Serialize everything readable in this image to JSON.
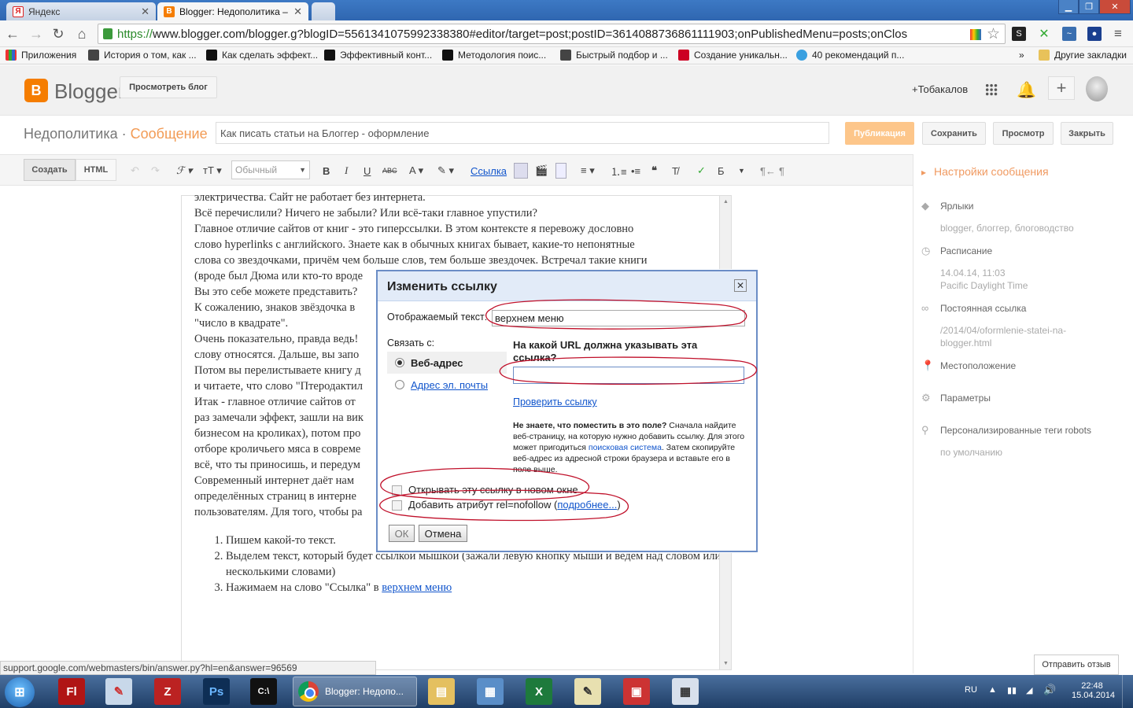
{
  "browser": {
    "tabs": [
      {
        "label": "Яндекс",
        "active": false,
        "favicon": "yandex-icon"
      },
      {
        "label": "Blogger: Недополитика –",
        "active": true,
        "favicon": "blogger-icon"
      }
    ],
    "url_scheme": "https://",
    "url_rest": "www.blogger.com/blogger.g?blogID=5561341075992338380#editor/target=post;postID=3614088736861111903;onPublishedMenu=posts;onClos",
    "bookmarks": [
      "Приложения",
      "История о том, как ...",
      "Как сделать эффект...",
      "Эффективный конт...",
      "Методология поис...",
      "Быстрый подбор и ...",
      "Создание уникальн...",
      "40 рекомендаций п..."
    ],
    "bookmarks_more": "»",
    "other_bookmarks": "Другие закладки"
  },
  "blogger": {
    "logo_text": "Blogger",
    "view_blog": "Просмотреть блог",
    "user": "+Тобакалов",
    "blog_name": "Недополитика",
    "separator": " · ",
    "section": "Сообщение",
    "post_title": "Как писать статьи на Блоггер - оформление",
    "publish": "Публикация",
    "save": "Сохранить",
    "preview": "Просмотр",
    "close": "Закрыть"
  },
  "editor_toolbar": {
    "compose": "Создать",
    "html": "HTML",
    "font_style": "Обычный",
    "bold": "B",
    "italic": "I",
    "underline": "U",
    "strike": "ABC",
    "link": "Ссылка",
    "spell": "Б"
  },
  "editor_body": {
    "lines": [
      "электричества. Сайт не работает без интернета.",
      "Всё перечислили? Ничего не забыли? Или всё-таки главное упустили?",
      "Главное отличие сайтов от книг - это гиперссылки. В этом контексте я перевожу дословно",
      "слово hyperlinks с английского. Знаете как в обычных книгах бывает, какие-то непонятные",
      "слова со звездочками, причём чем больше слов, тем больше звездочек. Встречал такие книги",
      "(вроде был Дюма или кто-то вроде",
      " Вы это себе можете представить?",
      " К сожалению, знаков звёздочка в",
      "\"число в квадрате\".",
      "Очень показательно, правда ведь!",
      "слову относятся. Дальше, вы запо",
      "Потом вы перелистываете книгу д",
      "и читаете, что слово \"Птеродактил",
      "Итак - главное отличие сайтов от",
      "раз замечали эффект, зашли на вик",
      "бизнесом на кроликах), потом про",
      "отборе кроличьего мяса в совреме",
      "всё, что ты приносишь, и передум",
      "Современный интернет даёт  нам",
      "определённых страниц в интерне",
      "пользователям. Для того, чтобы ра"
    ],
    "list": [
      "Пишем какой-то текст.",
      "Выделем текст, который будет ссылкой мышкой (зажали левую кнопку мыши и ведем над словом или несколькими словами)",
      "Нажимаем на слово \"Ссылка\" в "
    ],
    "list_link": "верхнем меню"
  },
  "sidebar": {
    "header": "Настройки сообщения",
    "labels_title": "Ярлыки",
    "labels_value": "blogger, блоггер, блоговодство",
    "schedule_title": "Расписание",
    "schedule_date": "14.04.14, 11:03",
    "schedule_tz": "Pacific Daylight Time",
    "permalink_title": "Постоянная ссылка",
    "permalink_value_1": "/2014/04/oformlenie-statei-na-",
    "permalink_value_2": "blogger.html",
    "location_title": "Местоположение",
    "options_title": "Параметры",
    "robots_title": "Персонализированные теги robots",
    "robots_value": "по умолчанию"
  },
  "dialog": {
    "title": "Изменить ссылку",
    "display_text_label": "Отображаемый текст:",
    "display_text_value": "верхнем меню",
    "link_to_label": "Связать с:",
    "option_web": "Веб-адрес",
    "option_email": "Адрес эл. почты",
    "url_question": "На какой URL должна указывать эта ссылка?",
    "url_value": "",
    "test_link": "Проверить ссылку",
    "help_bold": "Не знаете, что поместить в это поле?",
    "help_1": " Сначала найдите веб-страницу, на которую нужно добавить ссылку. Для этого может пригодиться ",
    "help_link": "поисковая система",
    "help_2": ". Затем скопируйте веб-адрес из адресной строки браузера и вставьте его в поле выше.",
    "new_window": "Открывать эту ссылку в новом окне",
    "nofollow": "Добавить атрибут rel=nofollow (",
    "nofollow_link": "подробнее...",
    "nofollow_end": ")",
    "ok": "ОК",
    "cancel": "Отмена"
  },
  "status_url": "support.google.com/webmasters/bin/answer.py?hl=en&answer=96569",
  "feedback": "Отправить отзыв",
  "taskbar": {
    "chrome_label": "Blogger: Недопо...",
    "lang": "RU",
    "time": "22:48",
    "date": "15.04.2014"
  },
  "colors": {
    "accent": "#f57d00",
    "publish": "#fdc68a",
    "annotation": "#c0102a"
  }
}
